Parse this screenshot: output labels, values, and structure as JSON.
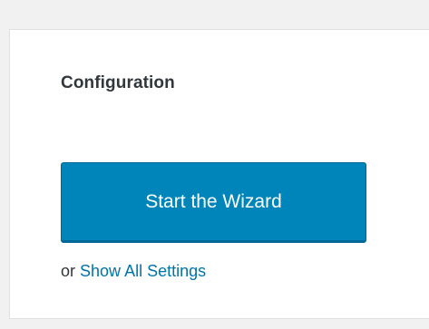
{
  "config_panel": {
    "title": "Configuration",
    "wizard_button_label": "Start the Wizard",
    "alt_prefix": "or",
    "show_all_settings_label": "Show All Settings"
  },
  "colors": {
    "page_background": "#f1f1f1",
    "panel_background": "#ffffff",
    "button_primary": "#0085ba",
    "button_border": "#006799",
    "link": "#0073aa",
    "text": "#32373c"
  }
}
